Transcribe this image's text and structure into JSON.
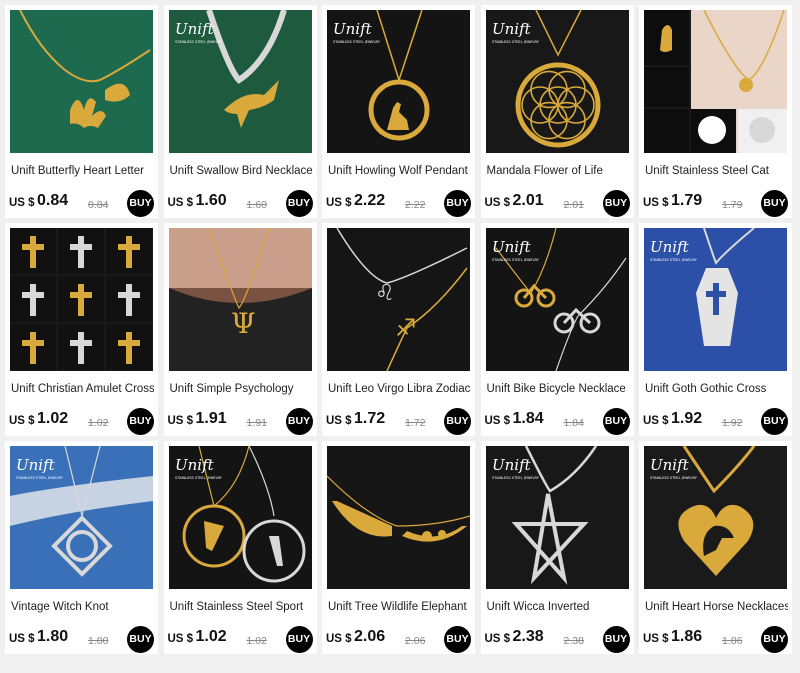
{
  "brand_logo": "Unift",
  "brand_tagline": "STAINLESS STEEL JEWELRY",
  "currency": "US $",
  "buy_label": "BUY",
  "products": [
    {
      "title": "Unift Butterfly Heart Letter",
      "price": "0.84",
      "old_price": "0.84",
      "bg": "#1e6a4e",
      "motif": "butterfly",
      "logo": false
    },
    {
      "title": "Unift Swallow Bird Necklace",
      "price": "1.60",
      "old_price": "1.60",
      "bg": "#1d5a3e",
      "motif": "swallow",
      "logo": true
    },
    {
      "title": "Unift Howling Wolf Pendant",
      "price": "2.22",
      "old_price": "2.22",
      "bg": "#141414",
      "motif": "wolf",
      "logo": true
    },
    {
      "title": "Mandala Flower of Life",
      "price": "2.01",
      "old_price": "2.01",
      "bg": "#181818",
      "motif": "mandala",
      "logo": true
    },
    {
      "title": "Unift Stainless Steel Cat",
      "price": "1.79",
      "old_price": "1.79",
      "bg": "#1a1a1a",
      "motif": "cat-collage",
      "logo": false
    },
    {
      "title": "Unift Christian Amulet Cross",
      "price": "1.02",
      "old_price": "1.02",
      "bg": "#1a1a1a",
      "motif": "cross-collage",
      "logo": false
    },
    {
      "title": "Unift Simple Psychology",
      "price": "1.91",
      "old_price": "1.91",
      "bg": "#6b4a3c",
      "motif": "psi",
      "logo": false
    },
    {
      "title": "Unift Leo Virgo Libra Zodiac",
      "price": "1.72",
      "old_price": "1.72",
      "bg": "#151515",
      "motif": "zodiac",
      "logo": false
    },
    {
      "title": "Unift Bike Bicycle Necklace",
      "price": "1.84",
      "old_price": "1.84",
      "bg": "#141414",
      "motif": "bike",
      "logo": true
    },
    {
      "title": "Unift Goth Gothic Cross",
      "price": "1.92",
      "old_price": "1.92",
      "bg": "#2c4fa8",
      "motif": "coffin",
      "logo": true
    },
    {
      "title": "Vintage Witch Knot",
      "price": "1.80",
      "old_price": "1.80",
      "bg": "#3a70b8",
      "motif": "witch-knot",
      "logo": true
    },
    {
      "title": "Unift Stainless Steel Sport",
      "price": "1.02",
      "old_price": "1.02",
      "bg": "#141414",
      "motif": "gymnast",
      "logo": true
    },
    {
      "title": "Unift Tree Wildlife Elephant",
      "price": "2.06",
      "old_price": "2.06",
      "bg": "#161616",
      "motif": "elephant",
      "logo": false
    },
    {
      "title": "Unift Wicca Inverted",
      "price": "2.38",
      "old_price": "2.38",
      "bg": "#181818",
      "motif": "pentagram",
      "logo": true
    },
    {
      "title": "Unift Heart Horse Necklaces",
      "price": "1.86",
      "old_price": "1.86",
      "bg": "#1a1a1a",
      "motif": "horse-heart",
      "logo": true
    }
  ]
}
